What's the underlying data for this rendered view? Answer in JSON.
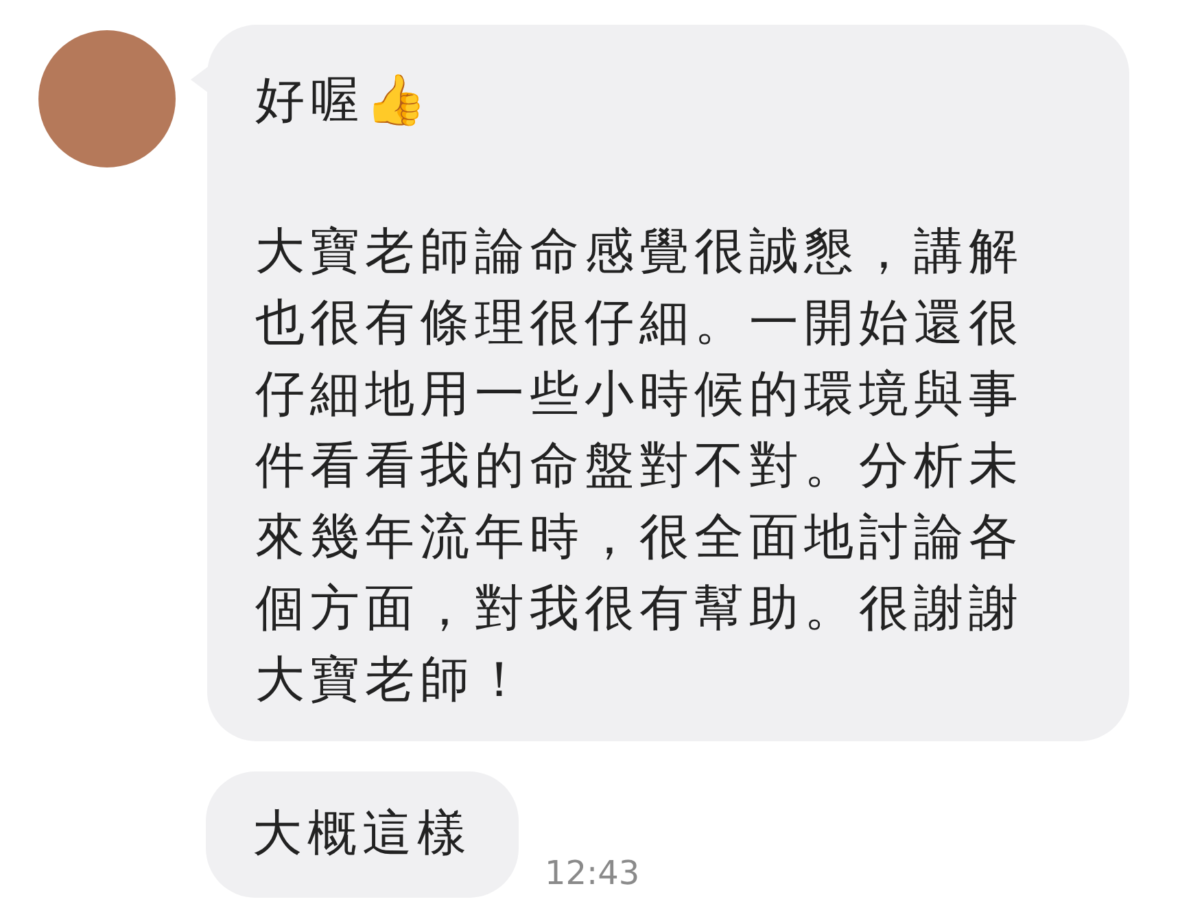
{
  "messages": [
    {
      "kind": "avatar_first",
      "paragraphs": [
        "好喔👍",
        "大寶老師論命感覺很誠懇，講解也很有條理很仔細。一開始還很仔細地用一些小時候的環境與事件看看我的命盤對不對。分析未來幾年流年時，很全面地討論各個方面，對我很有幫助。很謝謝大寶老師！"
      ]
    },
    {
      "kind": "followup",
      "paragraphs": [
        "大概這樣"
      ],
      "time": "12:43"
    }
  ]
}
